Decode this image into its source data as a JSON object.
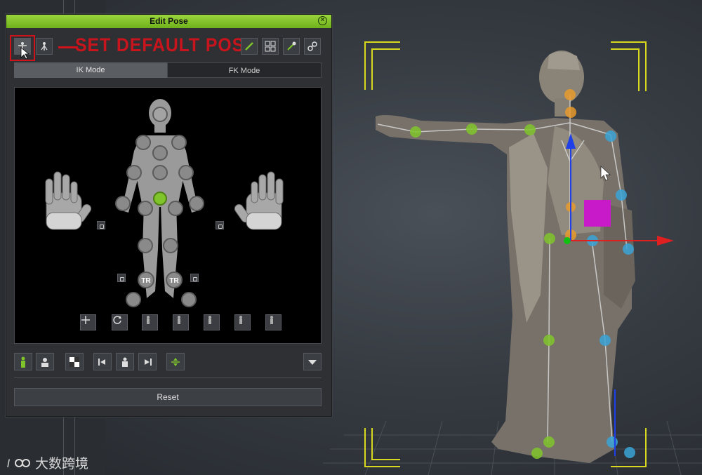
{
  "panel": {
    "title": "Edit Pose",
    "annotation": "SET DEFAULT POSE",
    "tabs": [
      {
        "label": "IK Mode",
        "active": true
      },
      {
        "label": "FK Mode",
        "active": false
      }
    ],
    "reset_label": "Reset",
    "joint_labels": {
      "left_foot": "TR",
      "right_foot": "TR"
    }
  },
  "watermark": {
    "logo": " ",
    "text": "大数跨境"
  },
  "colors": {
    "accent_green": "#7fc42a",
    "annotation_red": "#d0121b",
    "joint_orange": "#e89a2c",
    "joint_blue": "#3aa3d6",
    "gizmo_magenta": "#c81ac8",
    "axis_blue": "#1f3fe8",
    "axis_red": "#e02020",
    "frame_yellow": "#d8d81e"
  }
}
